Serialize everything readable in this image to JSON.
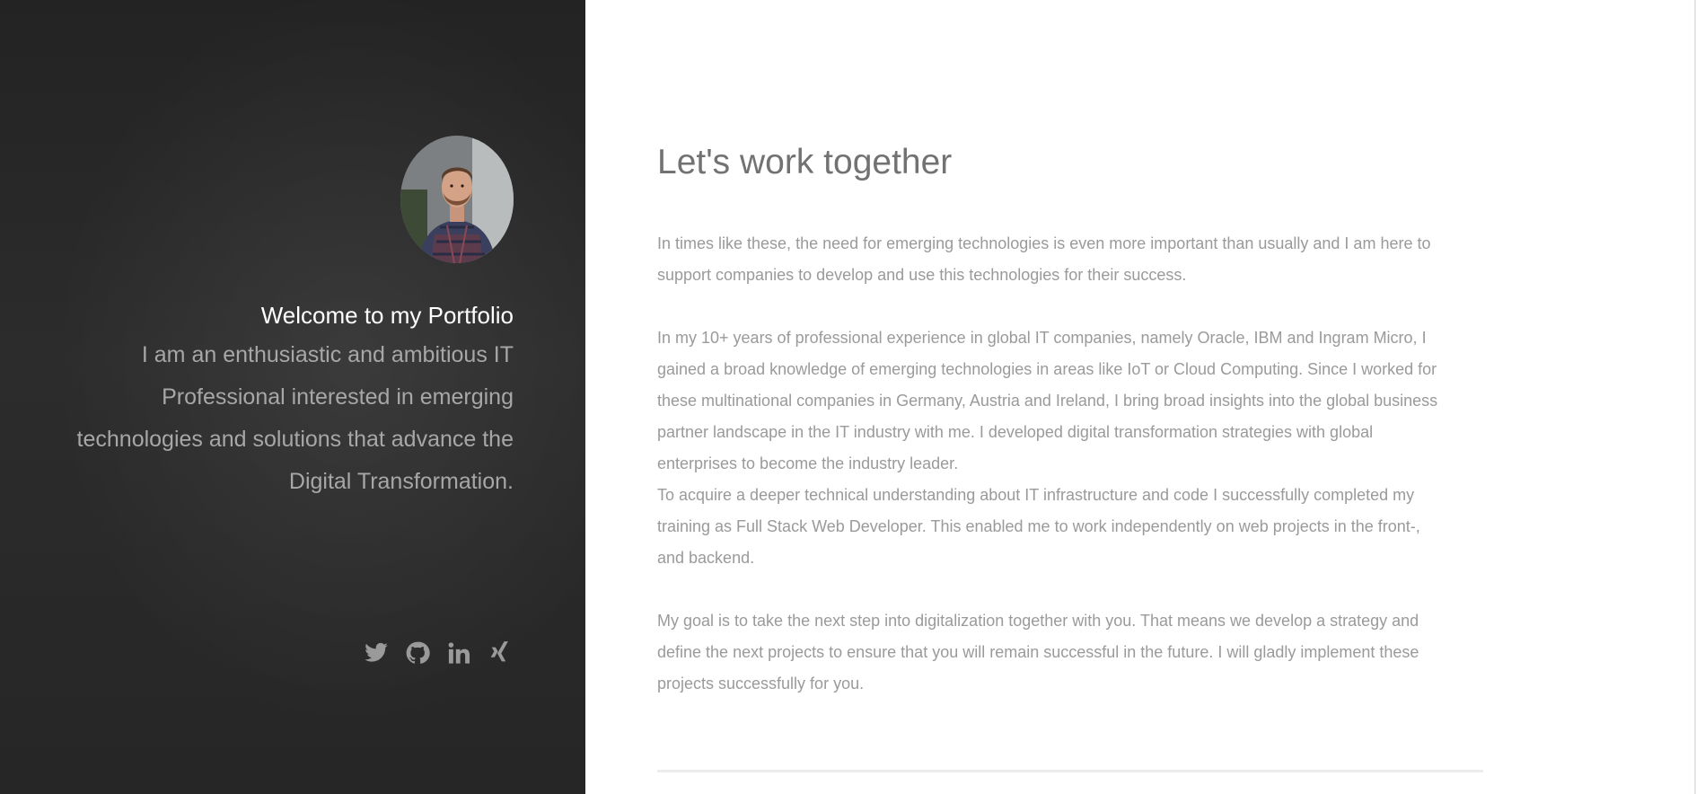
{
  "sidebar": {
    "welcome_title": "Welcome to my Portfolio",
    "intro_lines": [
      "I am an enthusiastic and ambitious IT",
      "Professional interested in emerging",
      "technologies and solutions that advance the",
      "Digital Transformation."
    ],
    "social_icons": [
      "twitter-icon",
      "github-icon",
      "linkedin-icon",
      "xing-icon"
    ]
  },
  "main": {
    "heading": "Let's work together",
    "paragraphs": [
      [
        "In times like these, the need for emerging technologies is even more important than usually and I am here to",
        "support companies to develop and use this technologies for their success."
      ],
      [
        "In my 10+ years of professional experience in global IT companies, namely Oracle, IBM and Ingram Micro, I",
        "gained a broad knowledge of emerging technologies in areas like IoT or Cloud Computing. Since I worked for",
        "these multinational companies in Germany, Austria and Ireland, I bring broad insights into the global business",
        "partner landscape in the IT industry with me. I developed digital transformation strategies with global",
        "enterprises to become the industry leader."
      ],
      [
        "To acquire a deeper technical understanding about IT infrastructure and code I successfully completed my",
        "training as Full Stack Web Developer. This enabled me to work independently on web projects in the front-,",
        "and backend."
      ],
      [
        "My goal is to take the next step into digitalization together with you. That means we develop a strategy and",
        "define the next projects to ensure that you will remain successful in the future. I will gladly implement these",
        "projects successfully for you."
      ]
    ]
  },
  "colors": {
    "sidebar_bg": "#2a2a2a",
    "heading": "#727272",
    "body_text": "#9a9a9a",
    "intro_text": "#a7a7a7",
    "title_text": "#ffffff"
  }
}
